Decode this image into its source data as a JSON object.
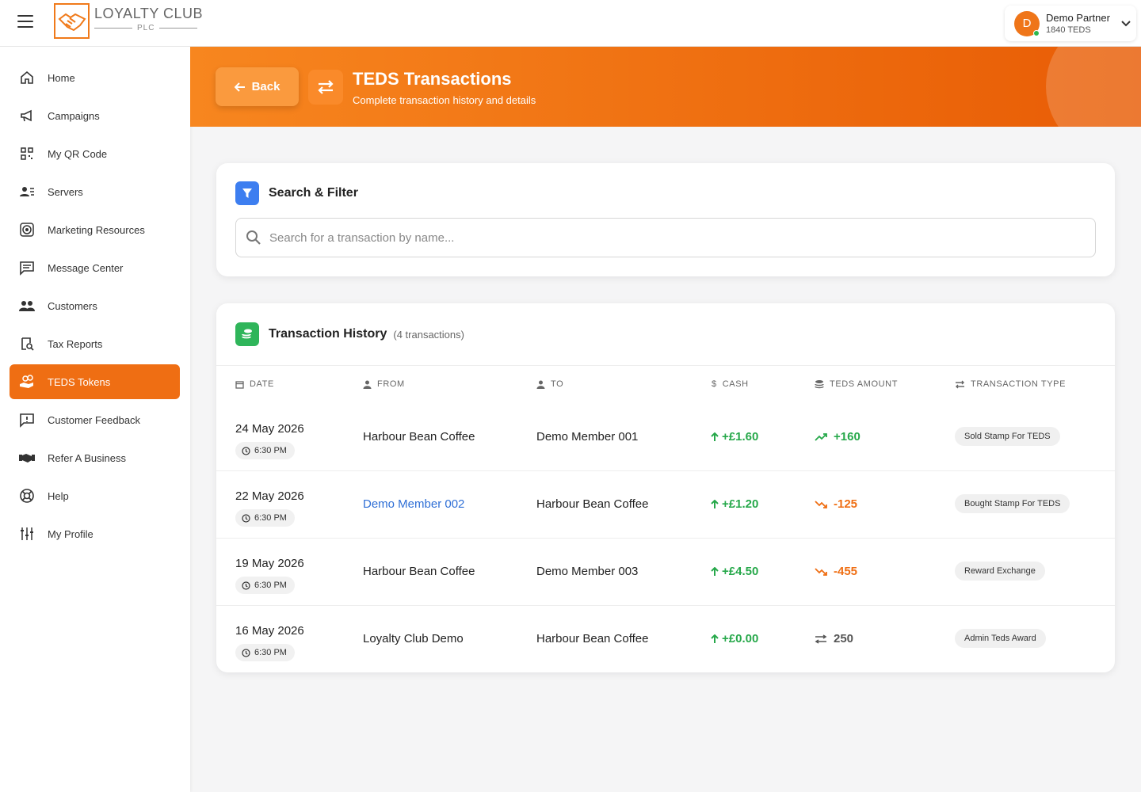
{
  "brand": {
    "title": "LOYALTY CLUB",
    "subtitle": "PLC"
  },
  "user": {
    "initial": "D",
    "name": "Demo Partner",
    "teds": "1840 TEDS"
  },
  "sidebar": {
    "items": [
      {
        "label": "Home",
        "icon": "home-icon"
      },
      {
        "label": "Campaigns",
        "icon": "megaphone-icon"
      },
      {
        "label": "My QR Code",
        "icon": "qr-code-icon"
      },
      {
        "label": "Servers",
        "icon": "user-list-icon"
      },
      {
        "label": "Marketing Resources",
        "icon": "target-icon"
      },
      {
        "label": "Message Center",
        "icon": "message-icon"
      },
      {
        "label": "Customers",
        "icon": "users-icon"
      },
      {
        "label": "Tax Reports",
        "icon": "clipboard-search-icon"
      },
      {
        "label": "TEDS Tokens",
        "icon": "coins-hand-icon",
        "active": true
      },
      {
        "label": "Customer Feedback",
        "icon": "feedback-icon"
      },
      {
        "label": "Refer A Business",
        "icon": "handshake-icon"
      },
      {
        "label": "Help",
        "icon": "lifebuoy-icon"
      },
      {
        "label": "My Profile",
        "icon": "sliders-icon"
      }
    ]
  },
  "header": {
    "back_label": "Back",
    "title": "TEDS Transactions",
    "subtitle": "Complete transaction history and details"
  },
  "search": {
    "title": "Search & Filter",
    "placeholder": "Search for a transaction by name..."
  },
  "history": {
    "title": "Transaction History",
    "count": "(4 transactions)",
    "columns": [
      "DATE",
      "FROM",
      "TO",
      "CASH",
      "TEDS AMOUNT",
      "TRANSACTION TYPE"
    ],
    "rows": [
      {
        "date": "24 May 2026",
        "time": "6:30 PM",
        "from": "Harbour Bean Coffee",
        "to": "Demo Member 001",
        "cash": "+£1.60",
        "amount": "+160",
        "direction": "up",
        "type": "Sold Stamp For TEDS"
      },
      {
        "date": "22 May 2026",
        "time": "6:30 PM",
        "from": "Demo Member 002",
        "from_link": true,
        "to": "Harbour Bean Coffee",
        "cash": "+£1.20",
        "amount": "-125",
        "direction": "down",
        "type": "Bought Stamp For TEDS"
      },
      {
        "date": "19 May 2026",
        "time": "6:30 PM",
        "from": "Harbour Bean Coffee",
        "to": "Demo Member 003",
        "cash": "+£4.50",
        "amount": "-455",
        "direction": "down",
        "type": "Reward Exchange"
      },
      {
        "date": "16 May 2026",
        "time": "6:30 PM",
        "from": "Loyalty Club Demo",
        "to": "Harbour Bean Coffee",
        "cash": "+£0.00",
        "amount": "250",
        "direction": "neutral",
        "type": "Admin Teds Award"
      }
    ]
  },
  "colors": {
    "accent": "#ef6e13",
    "positive": "#26a84a",
    "negative": "#ef6e13",
    "link": "#2f6fd6"
  }
}
